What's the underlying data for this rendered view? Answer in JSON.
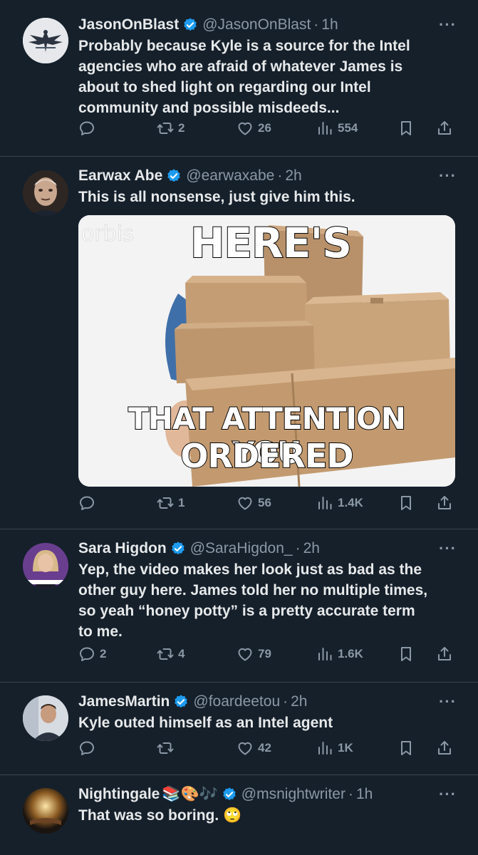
{
  "colors": {
    "background": "#15202b",
    "text": "#e7e9ea",
    "muted": "#8b98a5",
    "verified": "#1d9bf0",
    "divider": "#38444d"
  },
  "tweets": [
    {
      "name": "JasonOnBlast",
      "handle": "@JasonOnBlast",
      "dot": "·",
      "time": "1h",
      "more": "···",
      "lines": [
        "Probably because Kyle is a source for the Intel",
        "agencies who are afraid of whatever James is",
        "about to shed light on regarding our Intel",
        "community and possible misdeeds..."
      ],
      "replies": "",
      "retweets": "2",
      "likes": "26",
      "views": "554"
    },
    {
      "name": "Earwax Abe",
      "handle": "@earwaxabe",
      "dot": "·",
      "time": "2h",
      "more": "···",
      "lines": [
        "This is all nonsense, just give him this."
      ],
      "media": {
        "watermark": "orbis",
        "top_text": "HERE'S",
        "bottom_line1": "THAT ATTENTION YOU",
        "bottom_line2": "ORDERED"
      },
      "replies": "",
      "retweets": "1",
      "likes": "56",
      "views": "1.4K"
    },
    {
      "name": "Sara Higdon",
      "handle": "@SaraHigdon_",
      "dot": "·",
      "time": "2h",
      "more": "···",
      "lines": [
        "Yep, the video makes her look just as bad as the",
        "other guy here. James told her no multiple times,",
        "so yeah “honey potty” is a pretty accurate term",
        "to me."
      ],
      "replies": "2",
      "retweets": "4",
      "likes": "79",
      "views": "1.6K"
    },
    {
      "name": "JamesMartin",
      "handle": "@foardeetou",
      "dot": "·",
      "time": "2h",
      "more": "···",
      "lines": [
        "Kyle outed himself as an Intel agent"
      ],
      "replies": "",
      "retweets": "",
      "likes": "42",
      "views": "1K"
    },
    {
      "name": "Nightingale",
      "name_emojis": "📚🎨🎶",
      "handle": "@msnightwriter",
      "dot": "·",
      "time": "1h",
      "more": "···",
      "text": "That was so boring.",
      "text_emoji": "🙄"
    }
  ]
}
